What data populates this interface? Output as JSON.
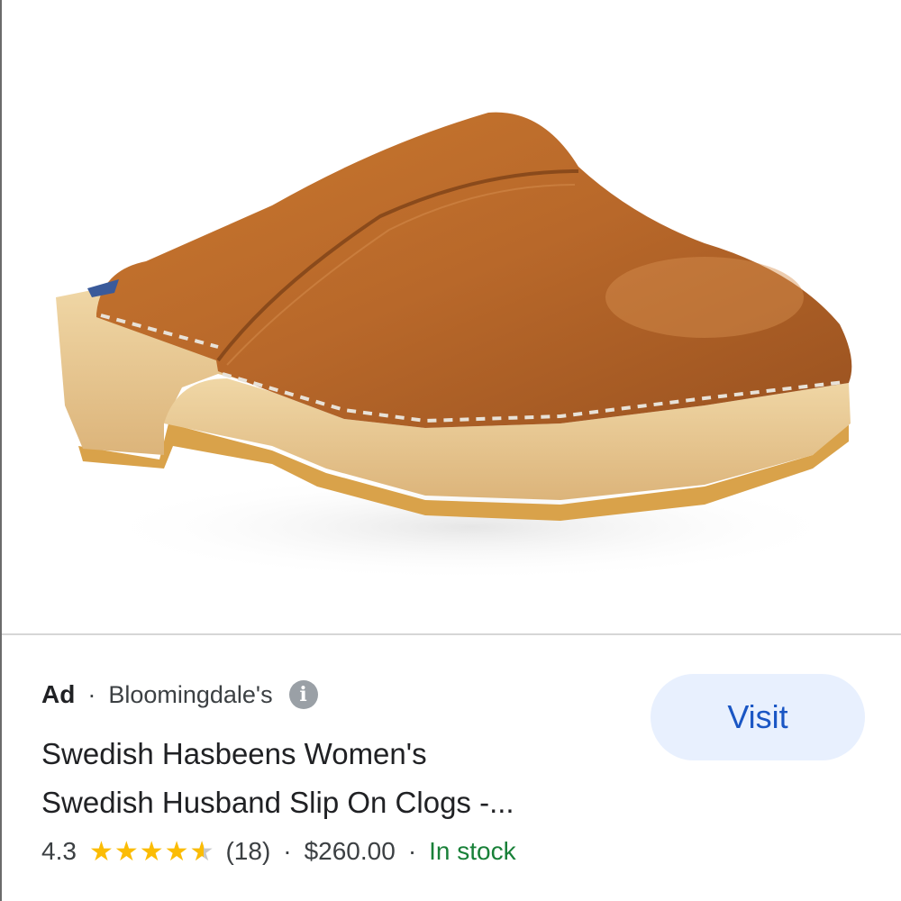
{
  "ad": {
    "label": "Ad",
    "separator": "·",
    "advertiser": "Bloomingdale's",
    "info_icon": "info-icon",
    "title_line1": "Swedish Hasbeens Women's",
    "title_line2": "Swedish Husband Slip On Clogs -...",
    "rating": "4.3",
    "rating_value": 4.3,
    "rating_max": 5,
    "review_count": "(18)",
    "price": "$260.00",
    "availability": "In stock",
    "visit_label": "Visit"
  },
  "product_image": {
    "description_icon": "clog-product-image",
    "colors": {
      "leather": "#b96a2c",
      "wood": "#e8c98f",
      "sole": "#d9a24a"
    }
  },
  "colors": {
    "visit_bg": "#e8f0fe",
    "visit_text": "#1a56c4",
    "stock_green": "#188038",
    "star_gold": "#fbbc04"
  }
}
